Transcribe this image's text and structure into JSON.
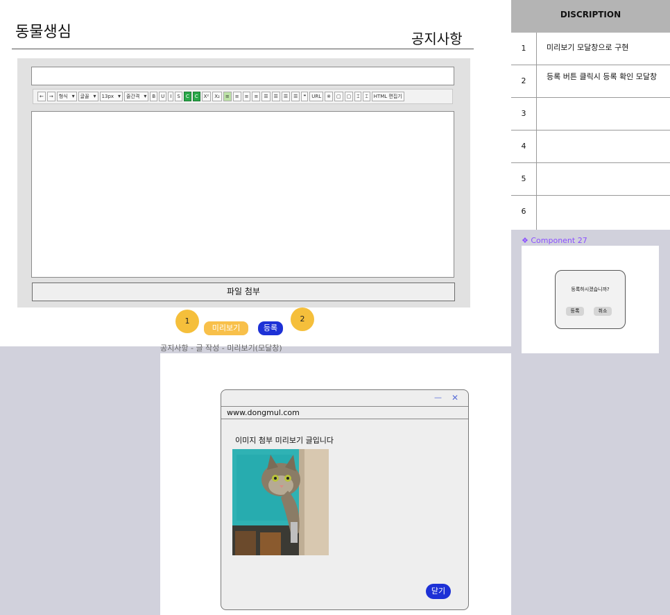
{
  "header": {
    "brand": "동물생심",
    "heading": "공지사항"
  },
  "editor": {
    "toolbar": {
      "items": [
        "←",
        "→",
        "형식",
        "글꼴",
        "13px",
        "줄간격",
        "B",
        "U",
        "I",
        "S",
        "C",
        "C",
        "X²",
        "X₂",
        "≡",
        "≡",
        "≡",
        "≡",
        "☰",
        "☰",
        "☰",
        "☰",
        "❝",
        "URL",
        "※",
        "▢",
        "▢",
        "⌶",
        "⌶",
        "HTML 편집기"
      ]
    },
    "attach_label": "파일 첨부"
  },
  "markers": {
    "one": "1",
    "two": "2"
  },
  "actions": {
    "preview_label": "미리보기",
    "register_label": "등록"
  },
  "frame_caption": "공지사항 - 글 작성 - 미리보기(모달창)",
  "modal": {
    "minimize": "—",
    "close_x": "✕",
    "url": "www.dongmul.com",
    "text": "이미지 첨부 미리보기 글입니다",
    "close_label": "닫기"
  },
  "description": {
    "header": "DISCRIPTION",
    "rows": [
      {
        "num": "1",
        "text": "미리보기 모달창으로 구현"
      },
      {
        "num": "2",
        "text": "등록 버튼 클릭시 등록 확인 모달창"
      },
      {
        "num": "3",
        "text": ""
      },
      {
        "num": "4",
        "text": ""
      },
      {
        "num": "5",
        "text": ""
      },
      {
        "num": "6",
        "text": ""
      }
    ]
  },
  "component": {
    "label": "❖ Component 27",
    "question": "등록하시겠습니까?",
    "ok": "등록",
    "cancel": "취소"
  },
  "colors": {
    "accent_yellow": "#f5bf3b",
    "accent_blue": "#1d31d6",
    "component_purple": "#8a4fff"
  }
}
